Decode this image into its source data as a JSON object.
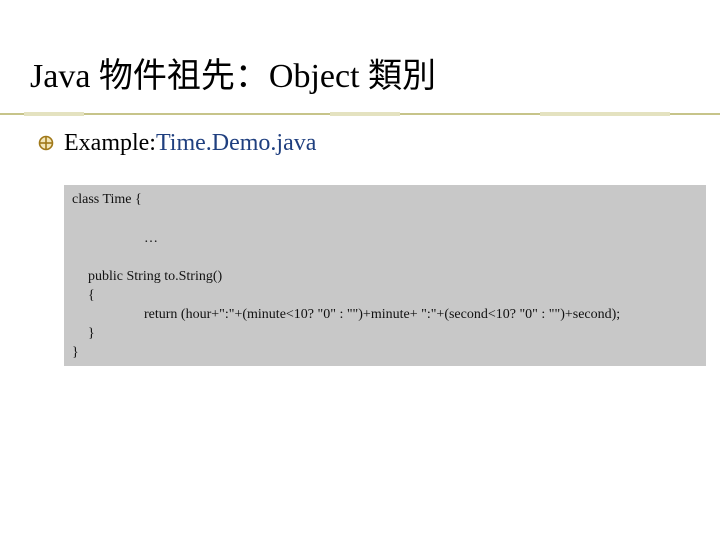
{
  "slide": {
    "title": "Java 物件祖先：Object 類別",
    "bullet": {
      "label": "Example: ",
      "file": "Time.Demo.java"
    },
    "code_lines": [
      "class Time {",
      "…",
      "public String to.String()",
      "{",
      "return (hour+\":\"+(minute<10? \"0\" : \"\")+minute+ \":\"+(second<10? \"0\" : \"\")+second);",
      "}",
      "}"
    ]
  },
  "colors": {
    "accent_file": "#1f3f7f",
    "code_background": "#c8c8c8",
    "bullet_icon": "#a07818",
    "rule": "#c7c48a"
  },
  "icons": {
    "bullet": "circle-cross-bullet-icon"
  }
}
